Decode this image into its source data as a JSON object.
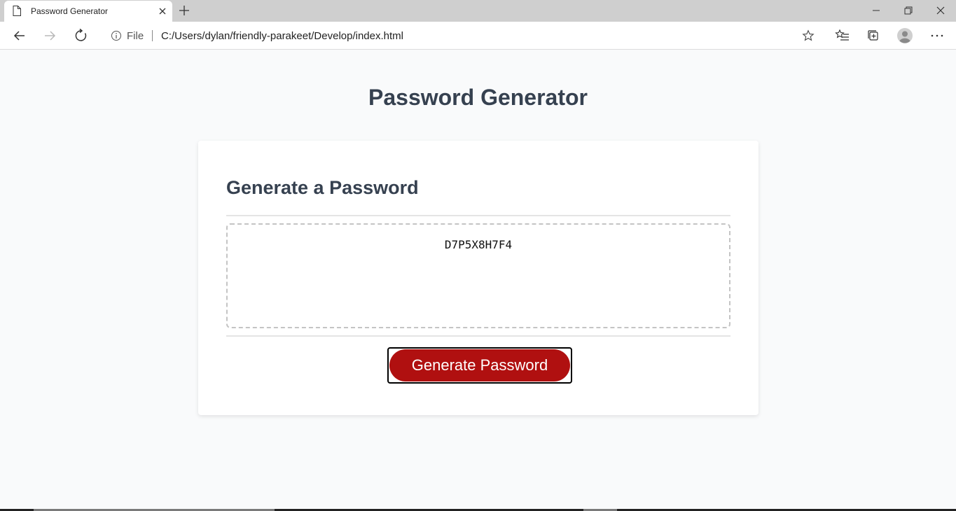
{
  "browser": {
    "tab": {
      "title": "Password Generator"
    },
    "address": {
      "scheme_label": "File",
      "url": "C:/Users/dylan/friendly-parakeet/Develop/index.html"
    }
  },
  "page": {
    "title": "Password Generator",
    "card": {
      "title": "Generate a Password",
      "password_value": "D7P5X8H7F4",
      "button_label": "Generate Password"
    }
  },
  "colors": {
    "heading": "#364150",
    "button": "#b01010",
    "page_background": "#f9fafb"
  },
  "icons": [
    "page-icon",
    "close-icon",
    "plus-icon",
    "minimize-icon",
    "restore-icon",
    "back-arrow-icon",
    "forward-arrow-icon",
    "refresh-icon",
    "info-icon",
    "star-icon",
    "favorites-icon",
    "collections-icon",
    "profile-icon",
    "more-icon"
  ]
}
